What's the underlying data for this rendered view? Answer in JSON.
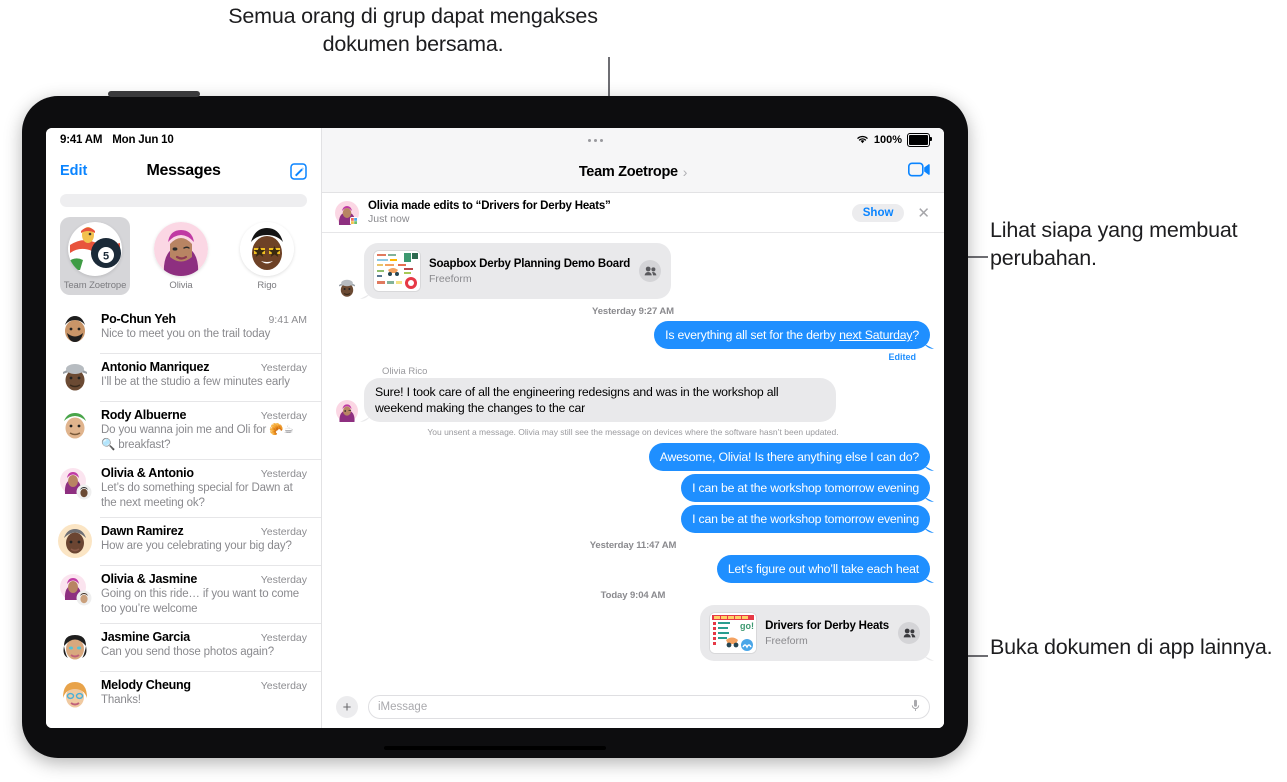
{
  "callouts": {
    "top": "Semua orang di grup dapat mengakses dokumen bersama.",
    "right_top": "Lihat siapa yang membuat perubahan.",
    "right_bottom": "Buka dokumen di app lainnya."
  },
  "sidebar": {
    "status": {
      "time": "9:41 AM",
      "date": "Mon Jun 10"
    },
    "nav": {
      "edit": "Edit",
      "title": "Messages",
      "compose_icon": "compose-icon"
    },
    "search_placeholder": "",
    "pinned": [
      {
        "label": "Team Zoetrope",
        "active": true
      },
      {
        "label": "Olivia",
        "active": false
      },
      {
        "label": "Rigo",
        "active": false
      }
    ],
    "conversations": [
      {
        "name": "Po-Chun Yeh",
        "time": "9:41 AM",
        "preview": "Nice to meet you on the trail today"
      },
      {
        "name": "Antonio Manriquez",
        "time": "Yesterday",
        "preview": "I’ll be at the studio a few minutes early"
      },
      {
        "name": "Rody Albuerne",
        "time": "Yesterday",
        "preview": "Do you wanna join me and Oli for 🥐☕🔍 breakfast?"
      },
      {
        "name": "Olivia & Antonio",
        "time": "Yesterday",
        "preview": "Let’s do something special for Dawn at the next meeting ok?"
      },
      {
        "name": "Dawn Ramirez",
        "time": "Yesterday",
        "preview": "How are you celebrating your big day?"
      },
      {
        "name": "Olivia & Jasmine",
        "time": "Yesterday",
        "preview": "Going on this ride… if you want to come too you’re welcome"
      },
      {
        "name": "Jasmine Garcia",
        "time": "Yesterday",
        "preview": "Can you send those photos again?"
      },
      {
        "name": "Melody Cheung",
        "time": "Yesterday",
        "preview": "Thanks!"
      }
    ]
  },
  "chat": {
    "status": {
      "wifi_icon": "wifi-icon",
      "battery_pct": "100%",
      "battery_icon": "battery-icon"
    },
    "title": "Team Zoetrope",
    "chevron": "›",
    "facetime_icon": "facetime-video-icon",
    "banner": {
      "title": "Olivia made edits to “Drivers for Derby Heats”",
      "subtitle": "Just now",
      "show_label": "Show",
      "close_icon": "close-icon"
    },
    "messages": [
      {
        "kind": "card",
        "side": "in",
        "title": "Soapbox Derby Planning Demo Board",
        "subtitle": "Freeform",
        "badge_icon": "people-icon"
      },
      {
        "kind": "timestamp",
        "text": "Yesterday 9:27 AM"
      },
      {
        "kind": "bubble",
        "side": "out",
        "text_before": "Is everything all set for the derby ",
        "text_underlined": "next Saturday",
        "text_after": "?",
        "edited_label": "Edited"
      },
      {
        "kind": "sender",
        "text": "Olivia Rico"
      },
      {
        "kind": "bubble",
        "side": "in",
        "text": "Sure! I took care of all the engineering redesigns and was in the workshop all weekend making the changes to the car"
      },
      {
        "kind": "sysnote",
        "text": "You unsent a message. Olivia may still see the message on devices where the software hasn’t been updated."
      },
      {
        "kind": "bubble",
        "side": "out",
        "text": "Awesome, Olivia! Is there anything else I can do?"
      },
      {
        "kind": "bubble",
        "side": "out",
        "text": "I can be at the workshop tomorrow evening"
      },
      {
        "kind": "bubble",
        "side": "out",
        "text": "I can be at the workshop tomorrow evening"
      },
      {
        "kind": "timestamp",
        "text": "Yesterday 11:47 AM"
      },
      {
        "kind": "bubble",
        "side": "out",
        "text": "Let’s figure out who’ll take each heat"
      },
      {
        "kind": "timestamp",
        "text": "Today 9:04 AM"
      },
      {
        "kind": "card",
        "side": "out",
        "title": "Drivers for Derby Heats",
        "subtitle": "Freeform",
        "badge_icon": "people-icon"
      }
    ],
    "composer": {
      "plus_icon": "plus-icon",
      "placeholder": "iMessage",
      "mic_icon": "microphone-icon"
    }
  },
  "colors": {
    "accent_blue": "#1f8fff",
    "link_blue": "#0a84ff",
    "bubble_gray": "#e9e9eb",
    "text_secondary": "#8a8a8e"
  }
}
